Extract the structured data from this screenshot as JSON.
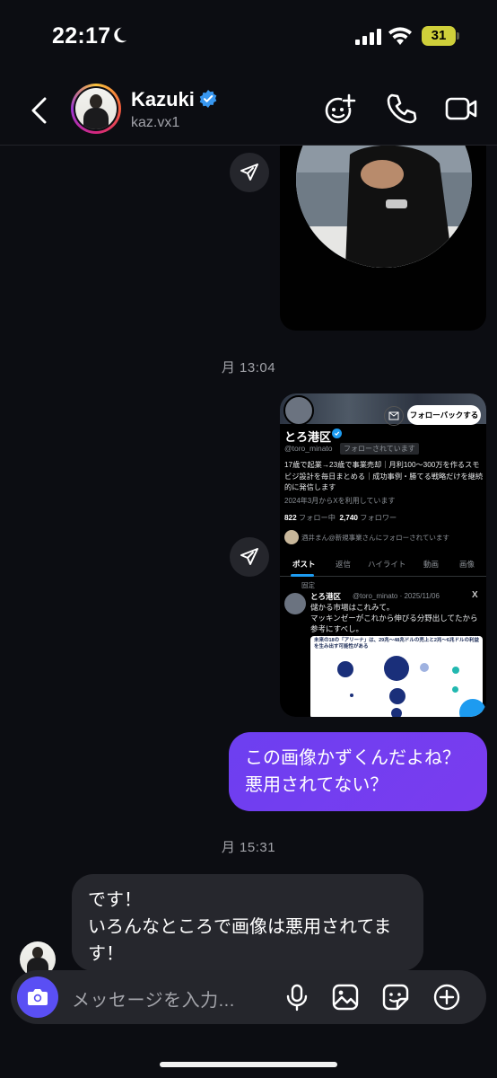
{
  "status_bar": {
    "time": "22:17",
    "battery": "31"
  },
  "header": {
    "name": "Kazuki",
    "username": "kaz.vx1"
  },
  "messages": {
    "timestamp_1": "月 13:04",
    "timestamp_2": "月 15:31",
    "outgoing_text_line1": "この画像かずくんだよね？",
    "outgoing_text_line2": "悪用されてない？",
    "incoming_text_line1": "です！",
    "incoming_text_line2": "いろんなところで画像は悪用されてま",
    "incoming_text_line3": "す！"
  },
  "shared_screenshot": {
    "follow_back": "フォローバックする",
    "display_name": "とろ港区",
    "handle": "@toro_minato",
    "follows_you": "フォローされています",
    "bio": "17歳で起業→23歳で事業売却｜月利100〜300万を作るスモビジ設計を毎日まとめる｜成功事例・勝てる戦略だけを継続的に発信します",
    "joined": "2024年3月からXを利用しています",
    "following_count": "822",
    "following_label": "フォロー中",
    "followers_count": "2,740",
    "followers_label": "フォロワー",
    "mutual": "酒井まん@新規事業さんにフォローされています",
    "tabs": [
      "ポスト",
      "返信",
      "ハイライト",
      "動画",
      "画像"
    ],
    "pinned": "固定",
    "post_meta": "@toro_minato · 2025/11/06",
    "post_text_line1": "儲かる市場はこれみて。",
    "post_text_line2": "マッキンゼーがこれから伸びる分野出してたから",
    "post_text_line3": "参考にすべし。",
    "infographic_title": "未来の18の「アリーナ」は、29兆〜48兆ドルの売上と2兆〜6兆ドルの利益を生み出す可能性がある"
  },
  "composer": {
    "placeholder": "メッセージを入力..."
  },
  "colors": {
    "background": "#0c0d12",
    "outgoing_bubble": "#7240ef",
    "incoming_bubble": "#26272d",
    "camera_button": "#5a4ff4",
    "verified_badge": "#3897f0"
  }
}
